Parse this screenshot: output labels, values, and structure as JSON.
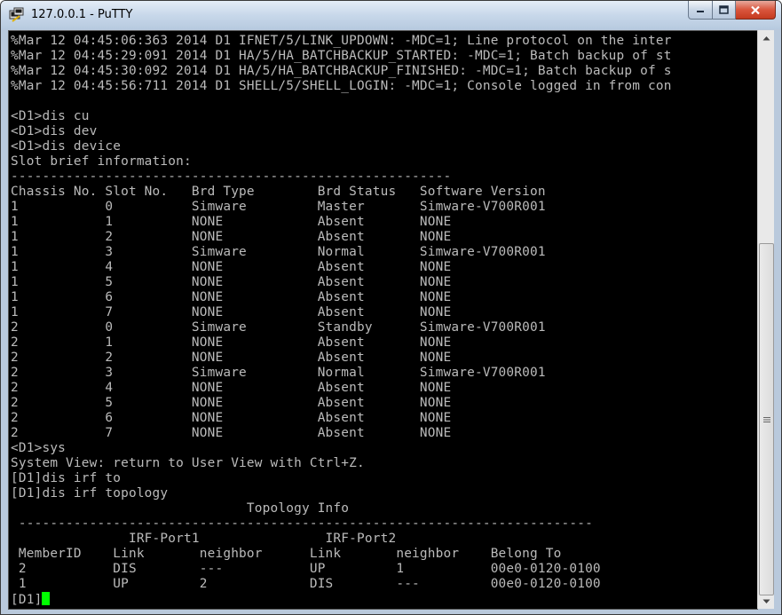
{
  "window": {
    "title": "127.0.0.1 - PuTTY"
  },
  "colors": {
    "terminal_bg": "#000000",
    "terminal_fg": "#bbbbbb",
    "cursor": "#00ff00"
  },
  "terminal": {
    "lines": [
      "%Mar 12 04:45:06:363 2014 D1 IFNET/5/LINK_UPDOWN: -MDC=1; Line protocol on the inter",
      "%Mar 12 04:45:29:091 2014 D1 HA/5/HA_BATCHBACKUP_STARTED: -MDC=1; Batch backup of st",
      "%Mar 12 04:45:30:092 2014 D1 HA/5/HA_BATCHBACKUP_FINISHED: -MDC=1; Batch backup of s",
      "%Mar 12 04:45:56:711 2014 D1 SHELL/5/SHELL_LOGIN: -MDC=1; Console logged in from con",
      "",
      "<D1>dis cu",
      "<D1>dis dev",
      "<D1>dis device",
      "Slot brief information:",
      "--------------------------------------------------------",
      "Chassis No. Slot No.   Brd Type        Brd Status   Software Version",
      "1           0          Simware         Master       Simware-V700R001",
      "1           1          NONE            Absent       NONE",
      "1           2          NONE            Absent       NONE",
      "1           3          Simware         Normal       Simware-V700R001",
      "1           4          NONE            Absent       NONE",
      "1           5          NONE            Absent       NONE",
      "1           6          NONE            Absent       NONE",
      "1           7          NONE            Absent       NONE",
      "2           0          Simware         Standby      Simware-V700R001",
      "2           1          NONE            Absent       NONE",
      "2           2          NONE            Absent       NONE",
      "2           3          Simware         Normal       Simware-V700R001",
      "2           4          NONE            Absent       NONE",
      "2           5          NONE            Absent       NONE",
      "2           6          NONE            Absent       NONE",
      "2           7          NONE            Absent       NONE",
      "<D1>sys",
      "System View: return to User View with Ctrl+Z.",
      "[D1]dis irf to",
      "[D1]dis irf topology",
      "                              Topology Info",
      " -------------------------------------------------------------------------",
      "               IRF-Port1                IRF-Port2",
      " MemberID    Link       neighbor      Link       neighbor    Belong To",
      " 2           DIS        ---           UP         1           00e0-0120-0100",
      " 1           UP         2             DIS        ---         00e0-0120-0100"
    ],
    "prompt": "[D1]"
  }
}
